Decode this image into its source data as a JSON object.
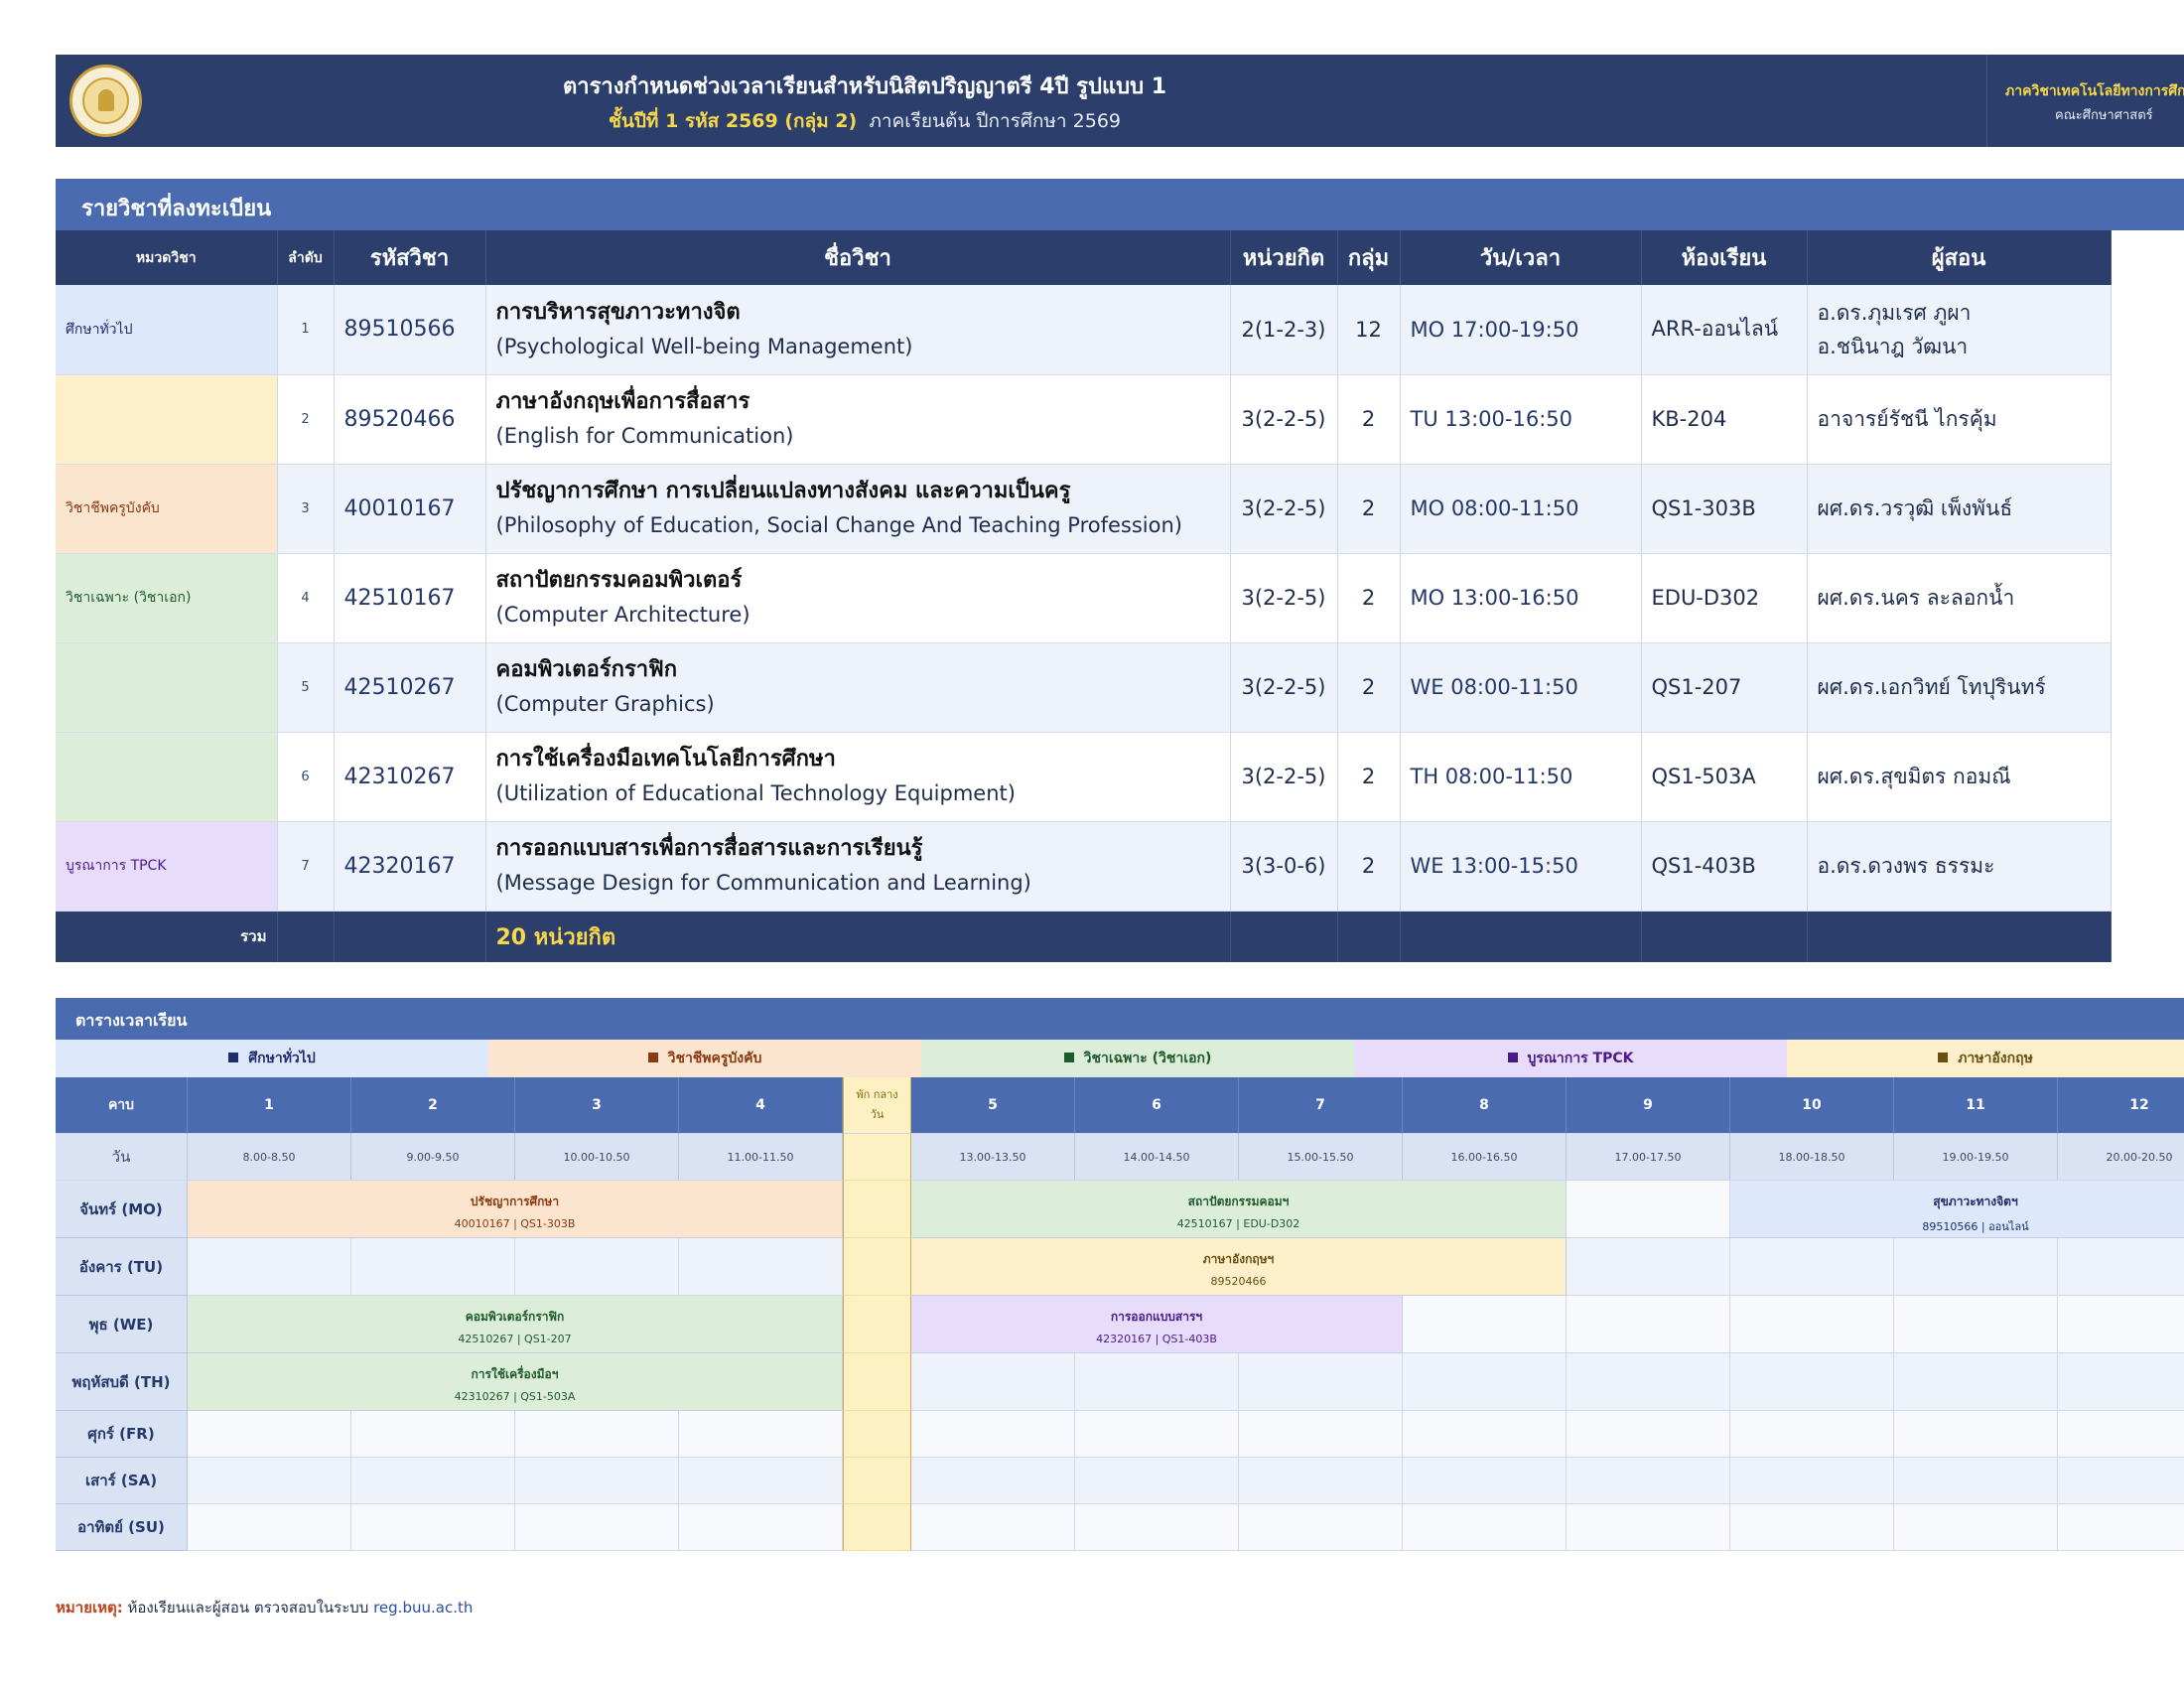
{
  "header": {
    "title": "ตารางกำหนดช่วงเวลาเรียนสำหรับนิสิตปริญญาตรี 4ปี รูปแบบ 1",
    "subtitle_highlight": "ชั้นปีที่ 1  รหัส 2569  (กลุ่ม 2)",
    "subtitle_rest": "ภาคเรียนต้น ปีการศึกษา 2569",
    "department": "ภาควิชาเทคโนโลยีทางการศึกษา",
    "faculty": "คณะศึกษาศาสตร์",
    "logo_icon": "university-seal-icon"
  },
  "courses": {
    "section_title": "รายวิชาที่ลงทะเบียน",
    "headers": {
      "category": "หมวดวิชา",
      "no": "ลำดับ",
      "code": "รหัสวิชา",
      "name": "ชื่อวิชา",
      "credits": "หน่วยกิต",
      "group": "กลุ่ม",
      "time": "วัน/เวลา",
      "room": "ห้องเรียน",
      "instructor": "ผู้สอน"
    },
    "rows": [
      {
        "category": "ศึกษาทั่วไป",
        "cat_bg": "#dde8fb",
        "no": "1",
        "code": "89510566",
        "name_th": "การบริหารสุขภาวะทางจิต",
        "name_en": "(Psychological Well-being Management)",
        "credits": "2(1-2-3)",
        "group": "12",
        "time": "MO 17:00-19:50",
        "room": "ARR-ออนไลน์",
        "instructor_1": "อ.ดร.ภุมเรศ ภูผา",
        "instructor_2": "อ.ชนินาฎ วัฒนา"
      },
      {
        "category": "",
        "cat_bg": "#fcefca",
        "no": "2",
        "code": "89520466",
        "name_th": "ภาษาอังกฤษเพื่อการสื่อสาร",
        "name_en": "(English for Communication)",
        "credits": "3(2-2-5)",
        "group": "2",
        "time": "TU 13:00-16:50",
        "room": "KB-204",
        "instructor_1": "อาจารย์รัชนี ไกรคุ้ม",
        "instructor_2": ""
      },
      {
        "category": "วิชาชีพครูบังคับ",
        "cat_bg": "#fbe5cf",
        "no": "3",
        "code": "40010167",
        "name_th": "ปรัชญาการศึกษา การเปลี่ยนแปลงทางสังคม และความเป็นครู",
        "name_en": "(Philosophy of Education, Social Change And Teaching Profession)",
        "credits": "3(2-2-5)",
        "group": "2",
        "time": "MO 08:00-11:50",
        "room": "QS1-303B",
        "instructor_1": "ผศ.ดร.วรวุฒิ เพ็งพันธ์",
        "instructor_2": ""
      },
      {
        "category": "วิชาเฉพาะ (วิชาเอก)",
        "cat_bg": "#dcedd9",
        "no": "4",
        "code": "42510167",
        "name_th": "สถาปัตยกรรมคอมพิวเตอร์",
        "name_en": "(Computer Architecture)",
        "credits": "3(2-2-5)",
        "group": "2",
        "time": "MO 13:00-16:50",
        "room": "EDU-D302",
        "instructor_1": "ผศ.ดร.นคร ละลอกน้ำ",
        "instructor_2": ""
      },
      {
        "category": "",
        "cat_bg": "#dcedd9",
        "no": "5",
        "code": "42510267",
        "name_th": "คอมพิวเตอร์กราฟิก",
        "name_en": "(Computer Graphics)",
        "credits": "3(2-2-5)",
        "group": "2",
        "time": "WE 08:00-11:50",
        "room": "QS1-207",
        "instructor_1": "ผศ.ดร.เอกวิทย์ โทปุรินทร์",
        "instructor_2": ""
      },
      {
        "category": "",
        "cat_bg": "#dcedd9",
        "no": "6",
        "code": "42310267",
        "name_th": "การใช้เครื่องมือเทคโนโลยีการศึกษา",
        "name_en": "(Utilization of Educational Technology Equipment)",
        "credits": "3(2-2-5)",
        "group": "2",
        "time": "TH 08:00-11:50",
        "room": "QS1-503A",
        "instructor_1": "ผศ.ดร.สุขมิตร กอมณี",
        "instructor_2": ""
      },
      {
        "category": "บูรณาการ TPCK",
        "cat_bg": "#e7dcf9",
        "no": "7",
        "code": "42320167",
        "name_th": "การออกแบบสารเพื่อการสื่อสารและการเรียนรู้",
        "name_en": "(Message Design for Communication and Learning)",
        "credits": "3(3-0-6)",
        "group": "2",
        "time": "WE 13:00-15:50",
        "room": "QS1-403B",
        "instructor_1": "อ.ดร.ดวงพร ธรรมะ",
        "instructor_2": ""
      }
    ],
    "total_label": "รวม",
    "total_credits": "20  หน่วยกิต"
  },
  "timetable": {
    "section_title": "ตารางเวลาเรียน",
    "legend": [
      {
        "label": "ศึกษาทั่วไป",
        "bg": "#dde8fb",
        "color": "#1f2d6b"
      },
      {
        "label": "วิชาชีพครูบังคับ",
        "bg": "#fbe5cf",
        "color": "#8a3a10"
      },
      {
        "label": "วิชาเฉพาะ (วิชาเอก)",
        "bg": "#dcedd9",
        "color": "#1f5a2a"
      },
      {
        "label": "บูรณาการ TPCK",
        "bg": "#e7dcf9",
        "color": "#4a1a8a"
      },
      {
        "label": "ภาษาอังกฤษ",
        "bg": "#fcefca",
        "color": "#6a5010"
      }
    ],
    "period_label": "คาบ",
    "day_label": "วัน",
    "lunch_label": "พัก กลางวัน",
    "periods": [
      "1",
      "2",
      "3",
      "4",
      "5",
      "6",
      "7",
      "8",
      "9",
      "10",
      "11",
      "12"
    ],
    "times": [
      "8.00-8.50",
      "9.00-9.50",
      "10.00-10.50",
      "11.00-11.50",
      "13.00-13.50",
      "14.00-14.50",
      "15.00-15.50",
      "16.00-16.50",
      "17.00-17.50",
      "18.00-18.50",
      "19.00-19.50",
      "20.00-20.50"
    ],
    "days": [
      "จันทร์ (MO)",
      "อังคาร (TU)",
      "พุธ (WE)",
      "พฤหัสบดี (TH)",
      "ศุกร์ (FR)",
      "เสาร์ (SA)",
      "อาทิตย์ (SU)"
    ],
    "blocks": [
      {
        "day": 0,
        "start": 1,
        "end": 4,
        "title": "ปรัชญาการศึกษา",
        "detail": "40010167 | QS1-303B",
        "bg": "#fbe5cf",
        "color": "#8a3a10"
      },
      {
        "day": 0,
        "start": 5,
        "end": 8,
        "title": "สถาปัตยกรรมคอมฯ",
        "detail": "42510167 | EDU-D302",
        "bg": "#dcedd9",
        "color": "#1f5a2a"
      },
      {
        "day": 0,
        "start": 10,
        "end": 12,
        "title": "สุขภาวะทางจิตฯ",
        "detail": "89510566 | ออนไลน์",
        "bg": "#dde8fb",
        "color": "#1f2d6b"
      },
      {
        "day": 1,
        "start": 5,
        "end": 8,
        "title": "ภาษาอังกฤษฯ",
        "detail": "89520466",
        "bg": "#fcefca",
        "color": "#6a5010"
      },
      {
        "day": 2,
        "start": 1,
        "end": 4,
        "title": "คอมพิวเตอร์กราฟิก",
        "detail": "42510267 | QS1-207",
        "bg": "#dcedd9",
        "color": "#1f5a2a"
      },
      {
        "day": 2,
        "start": 5,
        "end": 7,
        "title": "การออกแบบสารฯ",
        "detail": "42320167 | QS1-403B",
        "bg": "#e7dcf9",
        "color": "#4a1a8a"
      },
      {
        "day": 3,
        "start": 1,
        "end": 4,
        "title": "การใช้เครื่องมือฯ",
        "detail": "42310267 | QS1-503A",
        "bg": "#dcedd9",
        "color": "#1f5a2a"
      }
    ]
  },
  "note": {
    "label": "หมายเหตุ:",
    "text": "ห้องเรียนและผู้สอน ตรวจสอบในระบบ",
    "link": "reg.buu.ac.th"
  }
}
